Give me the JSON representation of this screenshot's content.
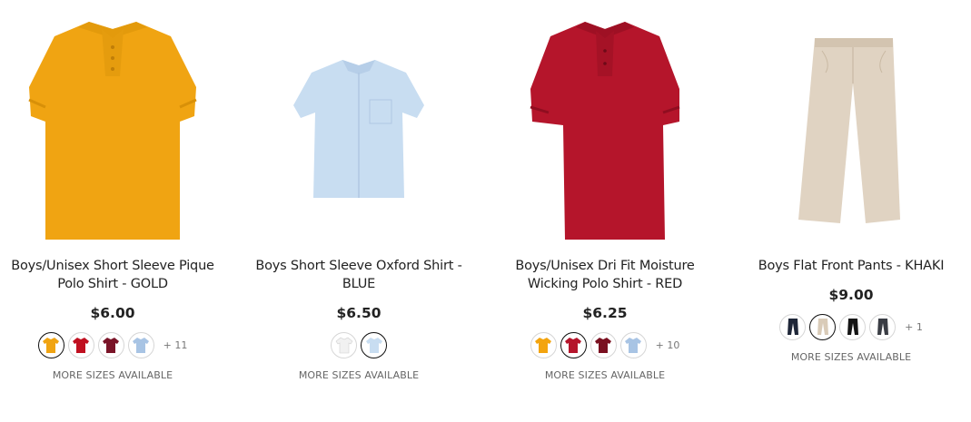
{
  "products": [
    {
      "title": "Boys/Unisex Short Sleeve Pique Polo Shirt - GOLD",
      "price": "$6.00",
      "image_icon": "polo-shirt-gold-image",
      "image_color": "#F0A412",
      "swatches": [
        {
          "icon": "polo-shirt-icon",
          "color": "#F0A412",
          "selected": true
        },
        {
          "icon": "polo-shirt-icon",
          "color": "#C01020",
          "selected": false
        },
        {
          "icon": "polo-shirt-icon",
          "color": "#7A1428",
          "selected": false
        },
        {
          "icon": "polo-shirt-icon",
          "color": "#A8C4E4",
          "selected": false
        }
      ],
      "more_count": "+ 11",
      "sizes_text": "MORE SIZES AVAILABLE"
    },
    {
      "title": "Boys Short Sleeve Oxford Shirt - BLUE",
      "price": "$6.50",
      "image_icon": "oxford-shirt-blue-image",
      "image_color": "#C8DDF1",
      "swatches": [
        {
          "icon": "oxford-shirt-icon",
          "color": "#F1F1F1",
          "selected": false
        },
        {
          "icon": "oxford-shirt-icon",
          "color": "#C8DDF1",
          "selected": true
        }
      ],
      "more_count": "",
      "sizes_text": "MORE SIZES AVAILABLE"
    },
    {
      "title": "Boys/Unisex Dri Fit Moisture Wicking Polo Shirt - RED",
      "price": "$6.25",
      "image_icon": "polo-shirt-red-image",
      "image_color": "#B5152B",
      "swatches": [
        {
          "icon": "polo-shirt-icon",
          "color": "#F3A40E",
          "selected": false
        },
        {
          "icon": "polo-shirt-icon",
          "color": "#B5152B",
          "selected": true
        },
        {
          "icon": "polo-shirt-icon",
          "color": "#7A1020",
          "selected": false
        },
        {
          "icon": "polo-shirt-icon",
          "color": "#A8C4E4",
          "selected": false
        }
      ],
      "more_count": "+ 10",
      "sizes_text": "MORE SIZES AVAILABLE"
    },
    {
      "title": "Boys Flat Front Pants - KHAKI",
      "price": "$9.00",
      "image_icon": "pants-khaki-image",
      "image_color": "#E0D3C2",
      "swatches": [
        {
          "icon": "pants-icon",
          "color": "#1E2638",
          "selected": false
        },
        {
          "icon": "pants-icon",
          "color": "#D9CBB8",
          "selected": true
        },
        {
          "icon": "pants-icon",
          "color": "#151515",
          "selected": false
        },
        {
          "icon": "pants-icon",
          "color": "#3A3D44",
          "selected": false
        }
      ],
      "more_count": "+ 1",
      "sizes_text": "MORE SIZES AVAILABLE"
    }
  ]
}
